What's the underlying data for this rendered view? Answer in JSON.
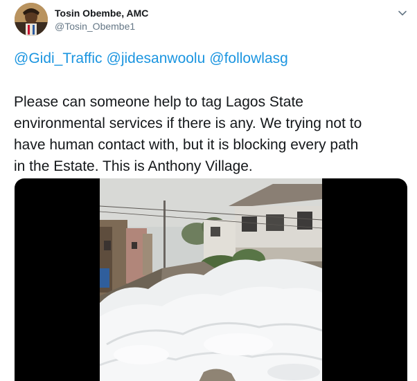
{
  "tweet": {
    "author": {
      "display_name": "Tosin Obembe, AMC",
      "handle": "@Tosin_Obembe1"
    },
    "mentions": [
      "@Gidi_Traffic",
      "@jidesanwoolu",
      "@followlasg"
    ],
    "body_lines": [
      "Please can someone help to tag Lagos State",
      "environmental services if there is any. We trying not to",
      "have human contact with, but it is blocking every path",
      "in the Estate. This is Anthony Village."
    ],
    "media": {
      "kind": "video",
      "letterbox_color": "#000000"
    },
    "more_menu_icon": "chevron-down-icon"
  },
  "colors": {
    "link": "#1b95e0",
    "text": "#14171a",
    "secondary": "#657786"
  }
}
